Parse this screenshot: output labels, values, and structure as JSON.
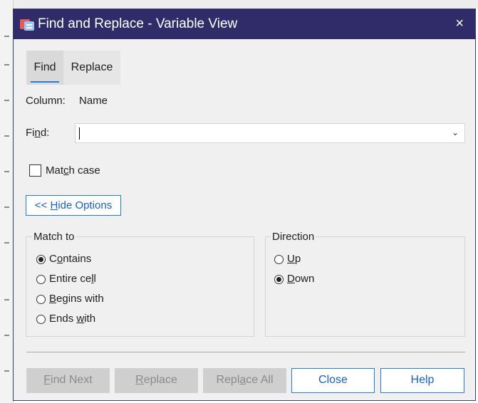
{
  "dialog": {
    "title": "Find and Replace - Variable View",
    "close_glyph": "×",
    "tabs": [
      {
        "label": "Find",
        "active": true
      },
      {
        "label": "Replace",
        "active": false
      }
    ],
    "column_label": "Column:",
    "column_value": "Name",
    "find_label_pre": "Fi",
    "find_label_u": "n",
    "find_label_post": "d:",
    "find_value": "",
    "dropdown_glyph": "⌄",
    "match_case_pre": "Mat",
    "match_case_u": "c",
    "match_case_post": "h case",
    "match_case_checked": false,
    "hide_options_pre": "<< ",
    "hide_options_u": "H",
    "hide_options_post": "ide Options",
    "match_to": {
      "title": "Match to",
      "options": [
        {
          "pre": "C",
          "u": "o",
          "post": "ntains",
          "selected": true
        },
        {
          "pre": "Entire ce",
          "u": "l",
          "post": "l",
          "selected": false
        },
        {
          "pre": "",
          "u": "B",
          "post": "egins with",
          "selected": false
        },
        {
          "pre": "Ends ",
          "u": "w",
          "post": "ith",
          "selected": false
        }
      ]
    },
    "direction": {
      "title": "Direction",
      "options": [
        {
          "pre": "",
          "u": "U",
          "post": "p",
          "selected": false
        },
        {
          "pre": "",
          "u": "D",
          "post": "own",
          "selected": true
        }
      ]
    },
    "buttons": {
      "find_next": {
        "pre": "",
        "u": "F",
        "post": "ind Next",
        "enabled": false
      },
      "replace": {
        "pre": "",
        "u": "R",
        "post": "eplace",
        "enabled": false
      },
      "replace_all": {
        "pre": "Repl",
        "u": "a",
        "post": "ce All",
        "enabled": false
      },
      "close": {
        "label": "Close",
        "enabled": true
      },
      "help": {
        "label": "Help",
        "enabled": true
      }
    }
  },
  "colors": {
    "titlebar": "#2f2c69",
    "accent": "#2a7bd6",
    "dialog_bg": "#f0f0f0"
  }
}
